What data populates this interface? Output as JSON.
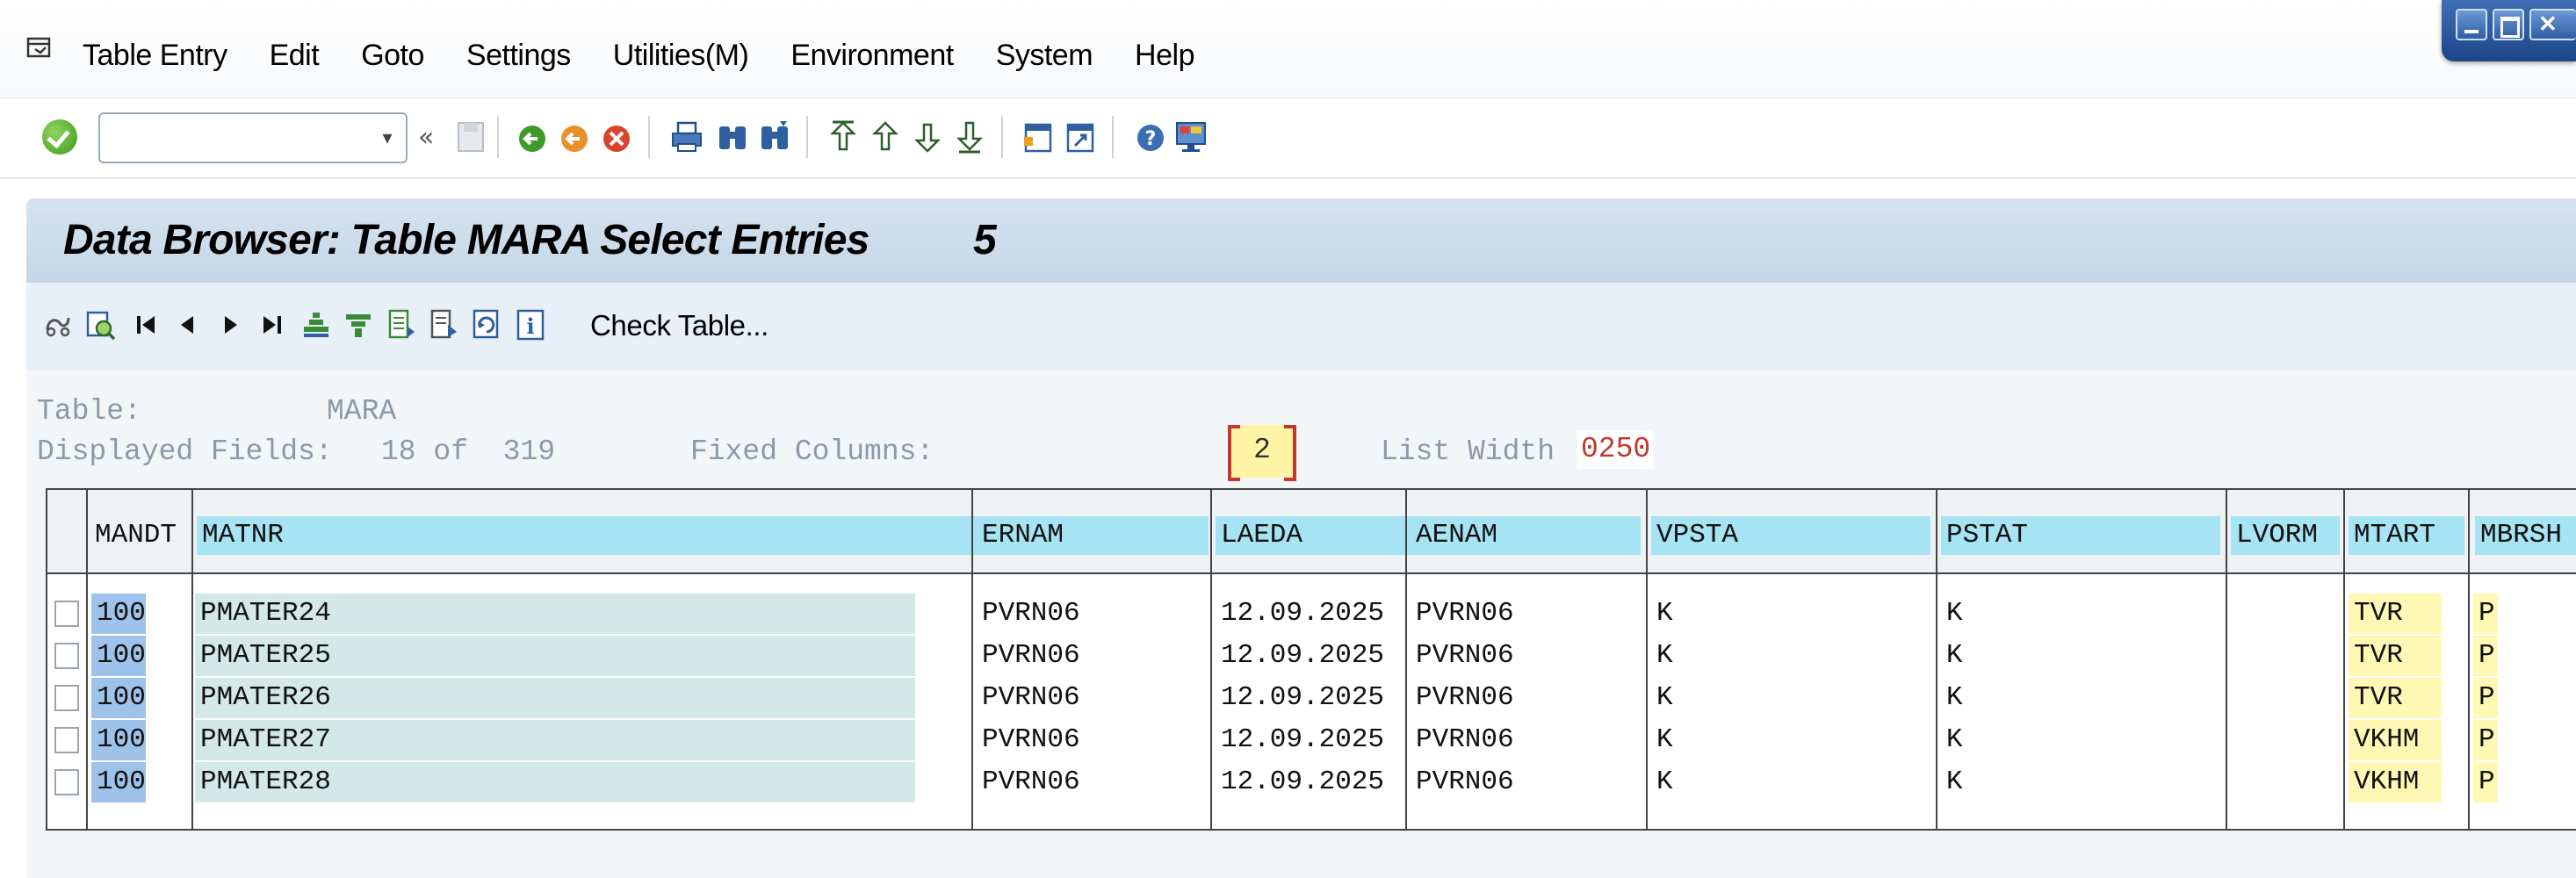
{
  "menu": {
    "items": [
      {
        "label": "Table Entry"
      },
      {
        "label": "Edit"
      },
      {
        "label": "Goto"
      },
      {
        "label": "Settings"
      },
      {
        "label": "Utilities(M)"
      },
      {
        "label": "Environment"
      },
      {
        "label": "System"
      },
      {
        "label": "Help"
      }
    ]
  },
  "toolbar": {
    "command_field_value": "",
    "icons": [
      "enter-icon",
      "back-icon",
      "exit-icon",
      "cancel-icon",
      "print-icon",
      "find-icon",
      "find-next-icon",
      "first-page-icon",
      "previous-page-icon",
      "next-page-icon",
      "last-page-icon",
      "create-session-icon",
      "shortcut-icon",
      "help-icon",
      "layout-icon"
    ]
  },
  "title": {
    "text": "Data Browser: Table MARA Select Entries",
    "count": "5"
  },
  "app_toolbar": {
    "check_table_label": "Check Table..."
  },
  "info": {
    "table_label": "Table:",
    "table_value": "MARA",
    "displayed_label": "Displayed Fields:",
    "displayed_value": "18 of  319",
    "fixed_label": "Fixed Columns:",
    "fixed_value": "2",
    "list_width_label": "List Width",
    "list_width_value": "0250"
  },
  "table": {
    "columns": [
      "MANDT",
      "MATNR",
      "ERNAM",
      "LAEDA",
      "AENAM",
      "VPSTA",
      "PSTAT",
      "LVORM",
      "MTART",
      "MBRSH"
    ],
    "rows": [
      {
        "mandt": "100",
        "matnr": "PMATER24",
        "ernam": "PVRN06",
        "laeda": "12.09.2025",
        "aenam": "PVRN06",
        "vpsta": "K",
        "pstat": "K",
        "lvorm": "",
        "mtart": "TVR",
        "mbrsh": "P"
      },
      {
        "mandt": "100",
        "matnr": "PMATER25",
        "ernam": "PVRN06",
        "laeda": "12.09.2025",
        "aenam": "PVRN06",
        "vpsta": "K",
        "pstat": "K",
        "lvorm": "",
        "mtart": "TVR",
        "mbrsh": "P"
      },
      {
        "mandt": "100",
        "matnr": "PMATER26",
        "ernam": "PVRN06",
        "laeda": "12.09.2025",
        "aenam": "PVRN06",
        "vpsta": "K",
        "pstat": "K",
        "lvorm": "",
        "mtart": "TVR",
        "mbrsh": "P"
      },
      {
        "mandt": "100",
        "matnr": "PMATER27",
        "ernam": "PVRN06",
        "laeda": "12.09.2025",
        "aenam": "PVRN06",
        "vpsta": "K",
        "pstat": "K",
        "lvorm": "",
        "mtart": "VKHM",
        "mbrsh": "P"
      },
      {
        "mandt": "100",
        "matnr": "PMATER28",
        "ernam": "PVRN06",
        "laeda": "12.09.2025",
        "aenam": "PVRN06",
        "vpsta": "K",
        "pstat": "K",
        "lvorm": "",
        "mtart": "VKHM",
        "mbrsh": "P"
      }
    ]
  },
  "colors": {
    "header_cell": "#a6e3f3",
    "key_cell": "#9ec3ea",
    "matnr_cell": "#d4e8e8",
    "highlight_cell": "#fff8b4",
    "accent_red": "#c0392b"
  }
}
